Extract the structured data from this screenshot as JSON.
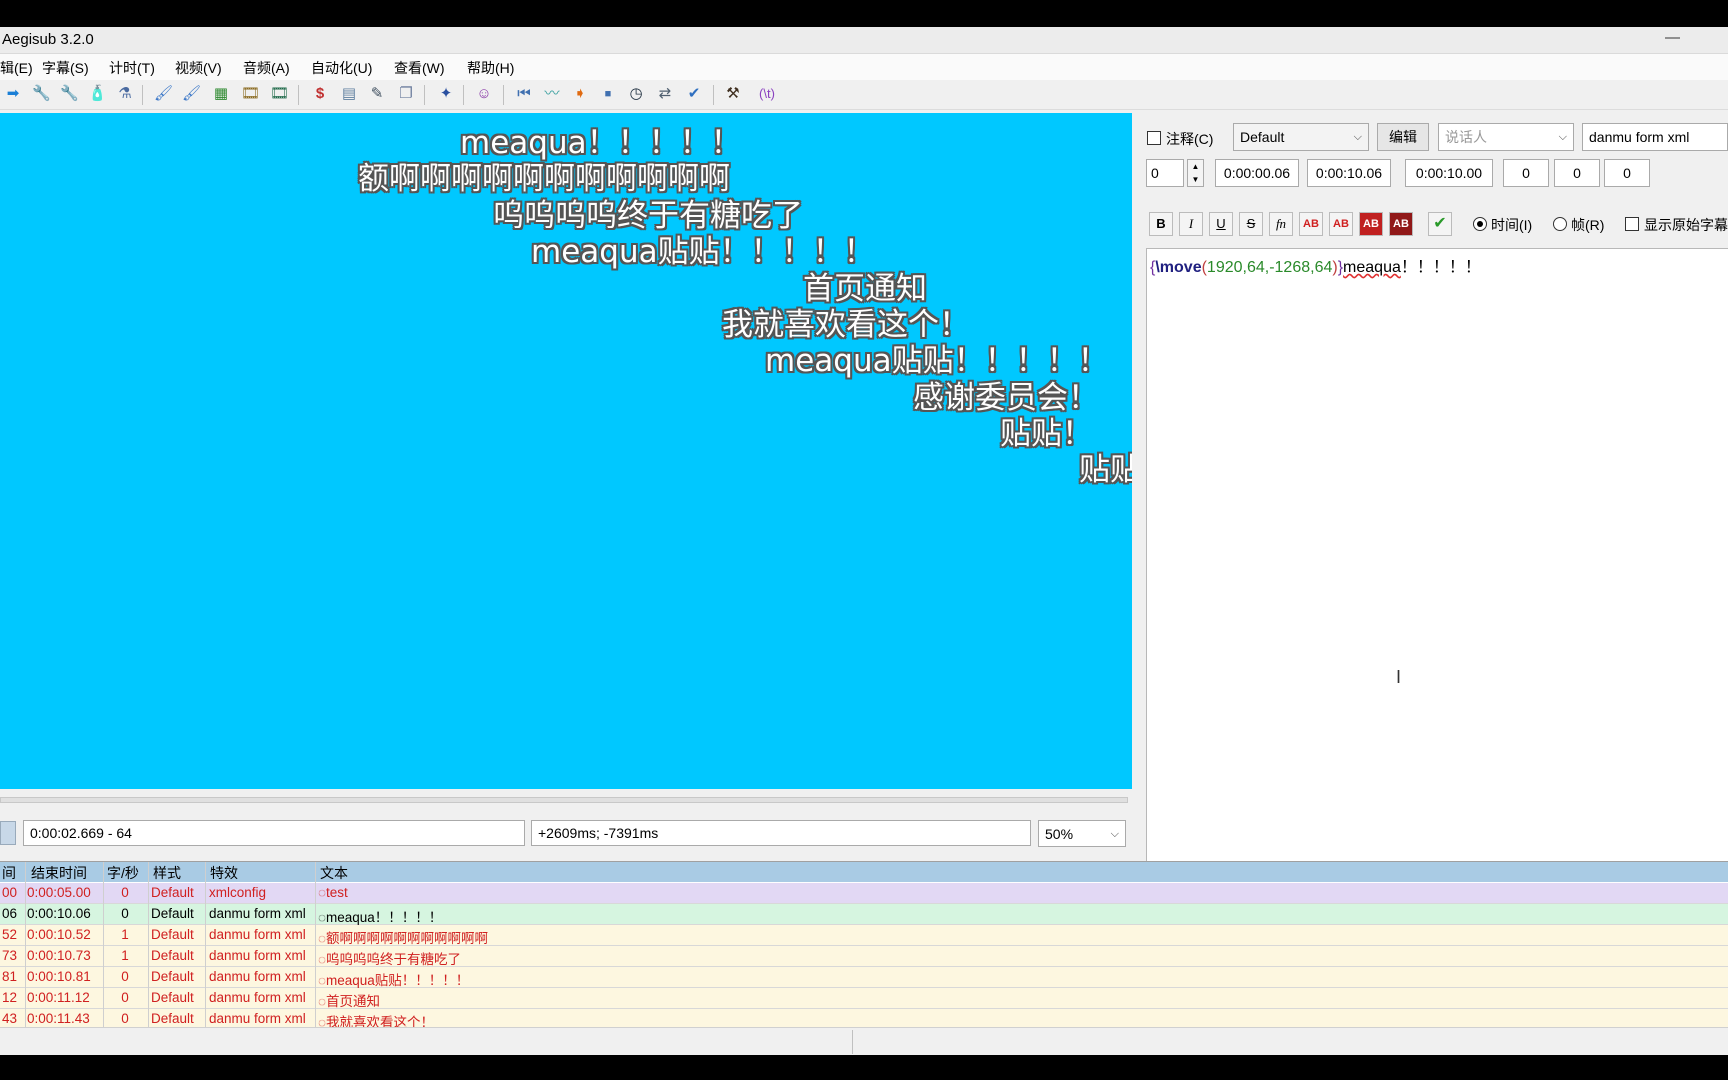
{
  "window": {
    "title": "Aegisub 3.2.0",
    "minimize_glyph": "—"
  },
  "menu": [
    "辑(E)",
    "字幕(S)",
    "计时(T)",
    "视频(V)",
    "音频(A)",
    "自动化(U)",
    "查看(W)",
    "帮助(H)"
  ],
  "toolbar": {
    "icons": [
      "arrow-right-icon",
      "wrench-icon",
      "wrench-alt-icon",
      "bottle-icon",
      "flask-icon",
      "paint-icon",
      "paint-alt-icon",
      "grid-icon",
      "film-icon",
      "film-alt-icon",
      "dollar-icon",
      "calculator-icon",
      "pencil-icon",
      "copy-icon",
      "puzzle-icon",
      "face-icon",
      "rewind-icon",
      "waveform-icon",
      "play-icon",
      "stop-icon",
      "clock-icon",
      "translate-icon",
      "spellcheck-icon",
      "hammer-icon",
      "tag-icon"
    ],
    "glyphs": [
      "➡",
      "🔧",
      "🔧",
      "🧴",
      "⚗",
      "🖌",
      "🖌",
      "▦",
      "🎞",
      "🎞",
      "$",
      "▤",
      "✎",
      "❐",
      "✦",
      "☺",
      "⏮",
      "〰",
      "➧",
      "■",
      "◷",
      "⇄",
      "✔",
      "⚒",
      "\\t"
    ],
    "tag_label": "(\\t)"
  },
  "video": {
    "background_color": "#00c8ff",
    "danmu": [
      "meaqua！！！！！",
      "额啊啊啊啊啊啊啊啊啊啊啊",
      "呜呜呜呜终于有糖吃了",
      "meaqua贴贴！！！！！",
      "首页通知",
      "我就喜欢看这个！",
      "meaqua贴贴！！！！！",
      "感谢委员会！",
      "贴贴！",
      "贴贴"
    ],
    "position_readout": "0:00:02.669 - 64",
    "offset_readout": "+2609ms; -7391ms",
    "zoom": "50%"
  },
  "edit": {
    "comment_label": "注释(C)",
    "style": "Default",
    "edit_button": "编辑",
    "actor_placeholder": "说话人",
    "effect": "danmu form xml",
    "layer": "0",
    "start_time": "0:00:00.06",
    "end_time": "0:00:10.06",
    "duration": "0:00:10.00",
    "margin_l": "0",
    "margin_r": "0",
    "margin_v": "0",
    "format_buttons": [
      "B",
      "I",
      "U",
      "S",
      "fn",
      "AB",
      "AB",
      "AB",
      "AB",
      "✔"
    ],
    "time_radio": "时间(I)",
    "frame_radio": "帧(R)",
    "show_original": "显示原始字幕",
    "text_parts": {
      "open": "{",
      "tag": "\\move",
      "paren_open": "(",
      "nums": "1920,64,-1268,64",
      "paren_close": ")",
      "close": "}",
      "body": "meaqua",
      "tail": "！！！！！"
    }
  },
  "grid": {
    "headers": [
      "间",
      "结束时间",
      "字/秒",
      "样式",
      "特效",
      "文本"
    ],
    "rows": [
      {
        "start": "00",
        "end": "0:00:05.00",
        "cps": "0",
        "style": "Default",
        "effect": "xmlconfig",
        "text": "◌test",
        "bg": "#e2d8f4",
        "color": "#d02020"
      },
      {
        "start": "06",
        "end": "0:00:10.06",
        "cps": "0",
        "style": "Default",
        "effect": "danmu form xml",
        "text": "◌meaqua！！！！！",
        "bg": "#d6f5e0",
        "color": "#000000"
      },
      {
        "start": "52",
        "end": "0:00:10.52",
        "cps": "1",
        "style": "Default",
        "effect": "danmu form xml",
        "text": "◌额啊啊啊啊啊啊啊啊啊啊啊",
        "bg": "#fdf7e0",
        "color": "#d02020"
      },
      {
        "start": "73",
        "end": "0:00:10.73",
        "cps": "1",
        "style": "Default",
        "effect": "danmu form xml",
        "text": "◌呜呜呜呜终于有糖吃了",
        "bg": "#fdf7e0",
        "color": "#d02020"
      },
      {
        "start": "81",
        "end": "0:00:10.81",
        "cps": "0",
        "style": "Default",
        "effect": "danmu form xml",
        "text": "◌meaqua贴贴！！！！！",
        "bg": "#fdf7e0",
        "color": "#d02020"
      },
      {
        "start": "12",
        "end": "0:00:11.12",
        "cps": "0",
        "style": "Default",
        "effect": "danmu form xml",
        "text": "◌首页通知",
        "bg": "#fdf7e0",
        "color": "#d02020"
      },
      {
        "start": "43",
        "end": "0:00:11.43",
        "cps": "0",
        "style": "Default",
        "effect": "danmu form xml",
        "text": "◌我就喜欢看这个！",
        "bg": "#fdf7e0",
        "color": "#d02020"
      }
    ]
  }
}
